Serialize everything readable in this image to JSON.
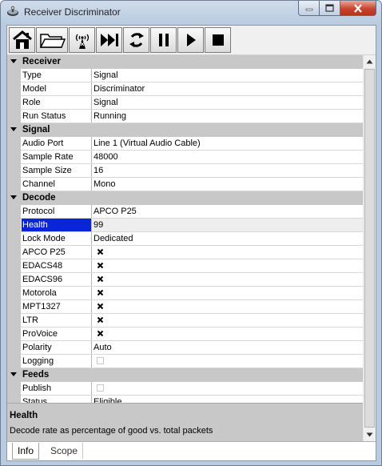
{
  "window": {
    "title": "Receiver Discriminator"
  },
  "toolbar": {
    "buttons": [
      {
        "icon": "home-icon"
      },
      {
        "icon": "open-folder-icon"
      },
      {
        "icon": "antenna-icon"
      },
      {
        "icon": "skip-forward-icon"
      },
      {
        "icon": "refresh-icon"
      },
      {
        "icon": "pause-icon"
      },
      {
        "icon": "play-icon"
      },
      {
        "icon": "stop-icon"
      }
    ]
  },
  "grid": {
    "categories": [
      {
        "label": "Receiver",
        "properties": [
          {
            "name": "Type",
            "value": "Signal"
          },
          {
            "name": "Model",
            "value": "Discriminator"
          },
          {
            "name": "Role",
            "value": "Signal"
          },
          {
            "name": "Run Status",
            "value": "Running"
          }
        ]
      },
      {
        "label": "Signal",
        "properties": [
          {
            "name": "Audio Port",
            "value": "Line 1 (Virtual Audio Cable)"
          },
          {
            "name": "Sample Rate",
            "value": "48000"
          },
          {
            "name": "Sample Size",
            "value": "16"
          },
          {
            "name": "Channel",
            "value": "Mono"
          }
        ]
      },
      {
        "label": "Decode",
        "properties": [
          {
            "name": "Protocol",
            "value": "APCO P25"
          },
          {
            "name": "Health",
            "value": "99",
            "selected": true
          },
          {
            "name": "Lock Mode",
            "value": "Dedicated"
          },
          {
            "name": "APCO P25",
            "checked": true
          },
          {
            "name": "EDACS48",
            "checked": true
          },
          {
            "name": "EDACS96",
            "checked": true
          },
          {
            "name": "Motorola",
            "checked": true
          },
          {
            "name": "MPT1327",
            "checked": true
          },
          {
            "name": "LTR",
            "checked": true
          },
          {
            "name": "ProVoice",
            "checked": true
          },
          {
            "name": "Polarity",
            "value": "Auto"
          },
          {
            "name": "Logging",
            "checked": false
          }
        ]
      },
      {
        "label": "Feeds",
        "properties": [
          {
            "name": "Publish",
            "checked": false
          },
          {
            "name": "Status",
            "value": "Eligible"
          }
        ]
      }
    ]
  },
  "help": {
    "title": "Health",
    "description": "Decode rate as percentage of good vs. total packets"
  },
  "tabs": [
    {
      "label": "Info",
      "active": true
    },
    {
      "label": "Scope",
      "active": false
    }
  ]
}
